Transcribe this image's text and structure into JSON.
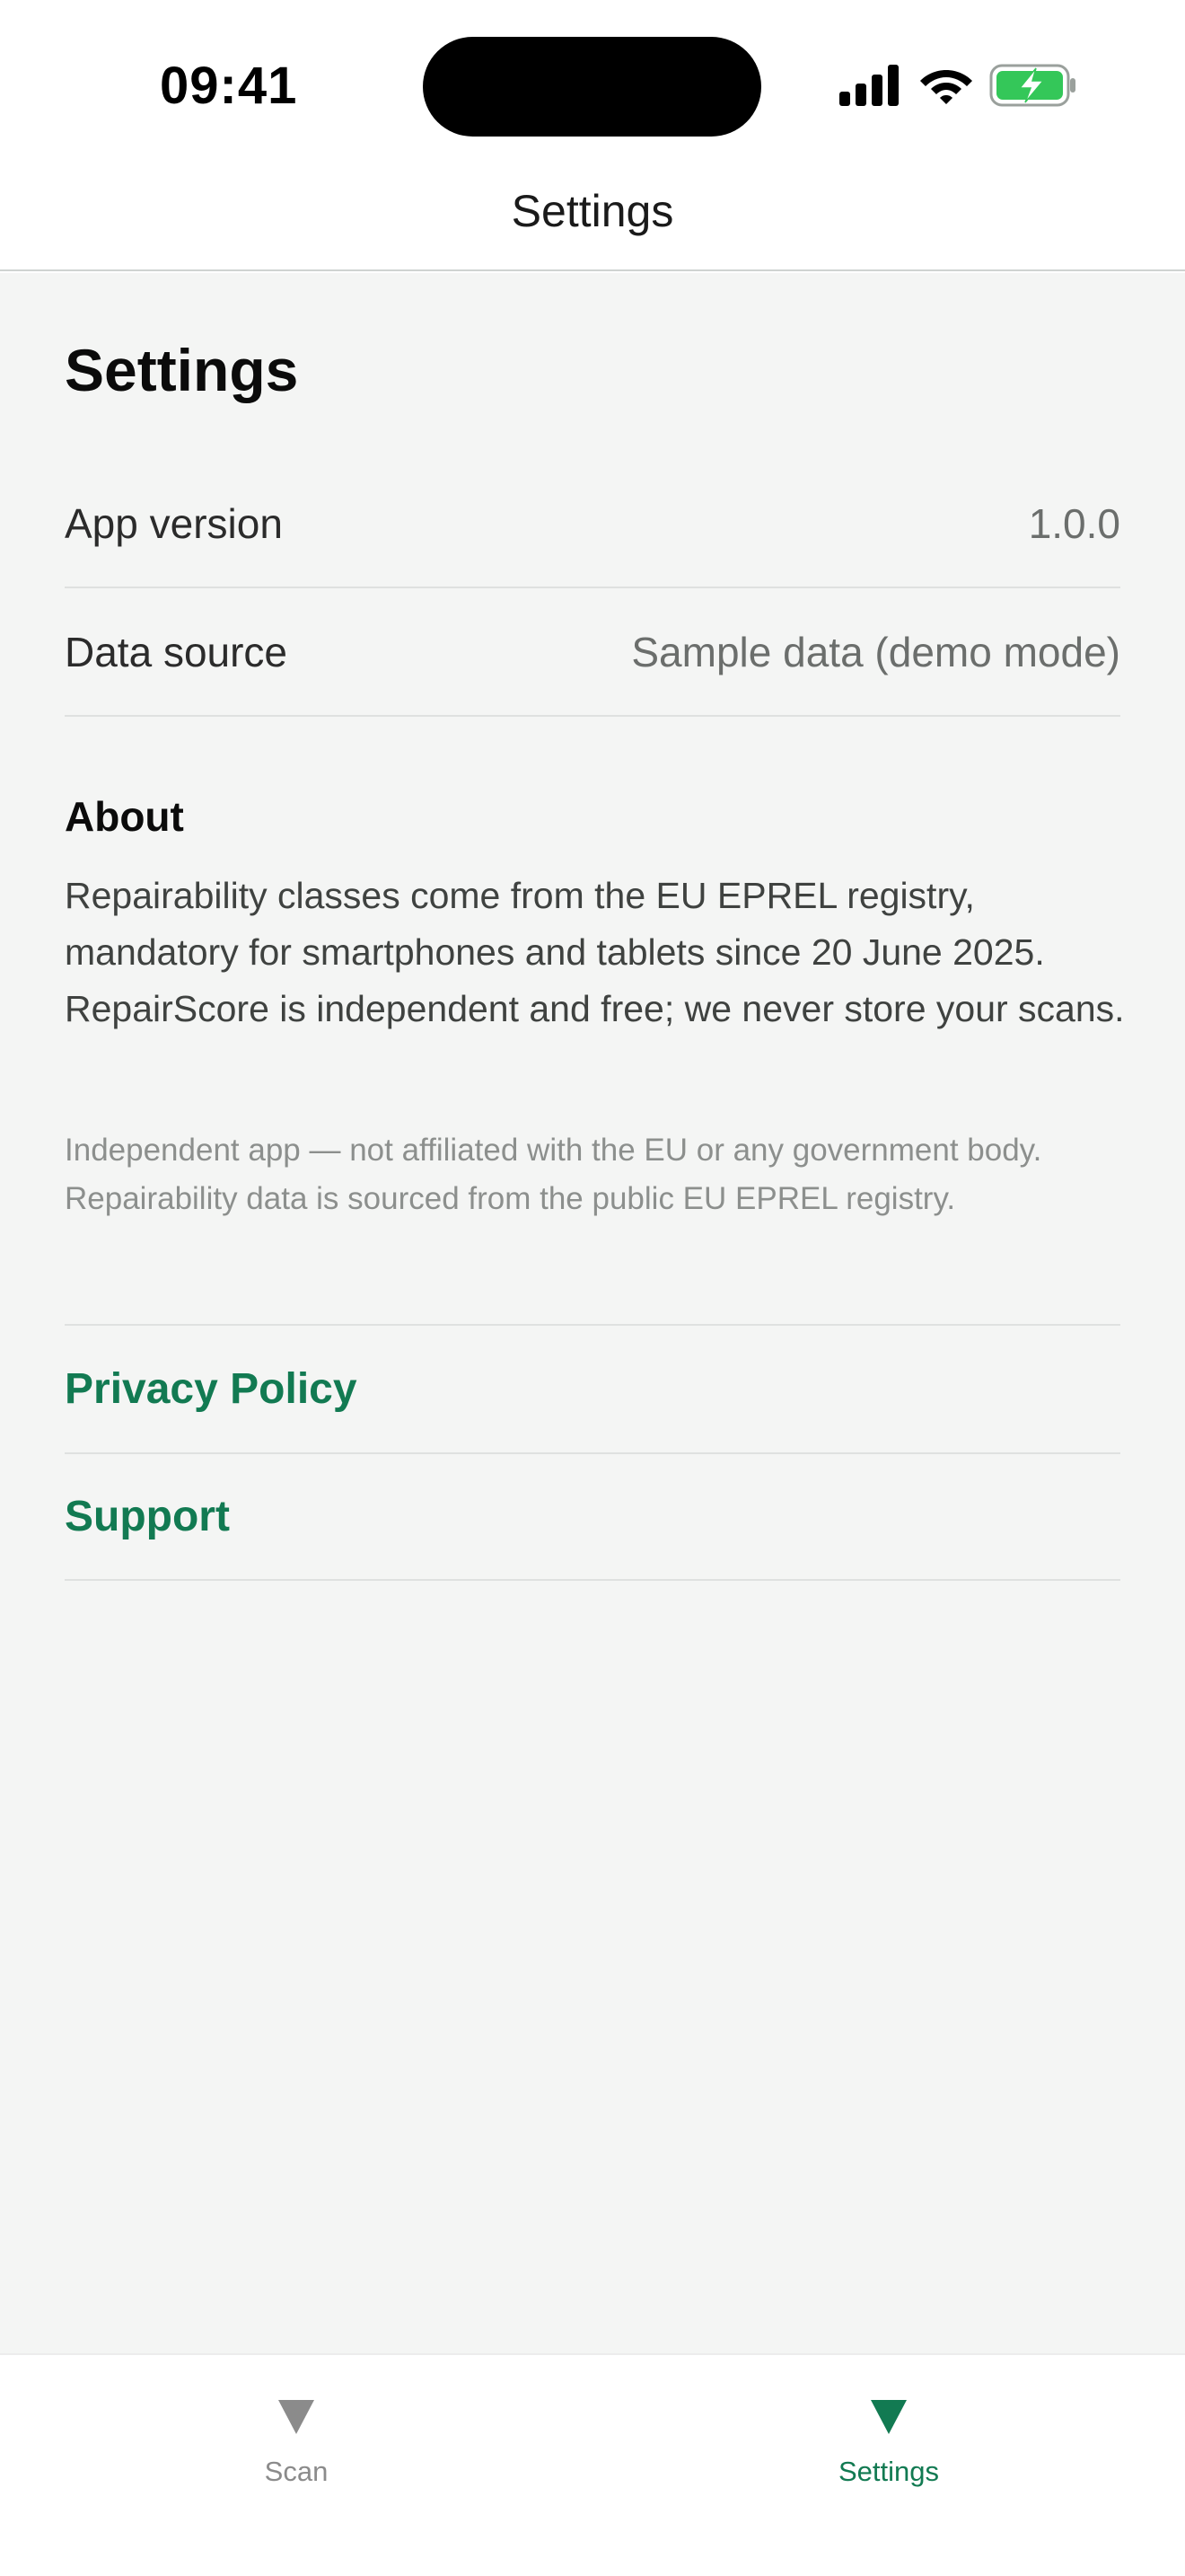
{
  "status_bar": {
    "time": "09:41"
  },
  "nav": {
    "title": "Settings"
  },
  "page": {
    "title": "Settings"
  },
  "info_rows": [
    {
      "label": "App version",
      "value": "1.0.0"
    },
    {
      "label": "Data source",
      "value": "Sample data (demo mode)"
    }
  ],
  "about": {
    "heading": "About",
    "text": "Repairability classes come from the EU EPREL registry, mandatory for smartphones and tablets since 20 June 2025. RepairScore is independent and free; we never store your scans.",
    "disclaimer": "Independent app — not affiliated with the EU or any government body. Repairability data is sourced from the public EU EPREL registry."
  },
  "links": {
    "privacy": "Privacy Policy",
    "support": "Support"
  },
  "tabs": [
    {
      "label": "Scan",
      "icon": "triangle-down-icon",
      "active": false
    },
    {
      "label": "Settings",
      "icon": "triangle-down-icon",
      "active": true
    }
  ],
  "colors": {
    "accent": "#127a52",
    "inactive_tab": "#8b8b8b",
    "background": "#f4f5f4"
  }
}
